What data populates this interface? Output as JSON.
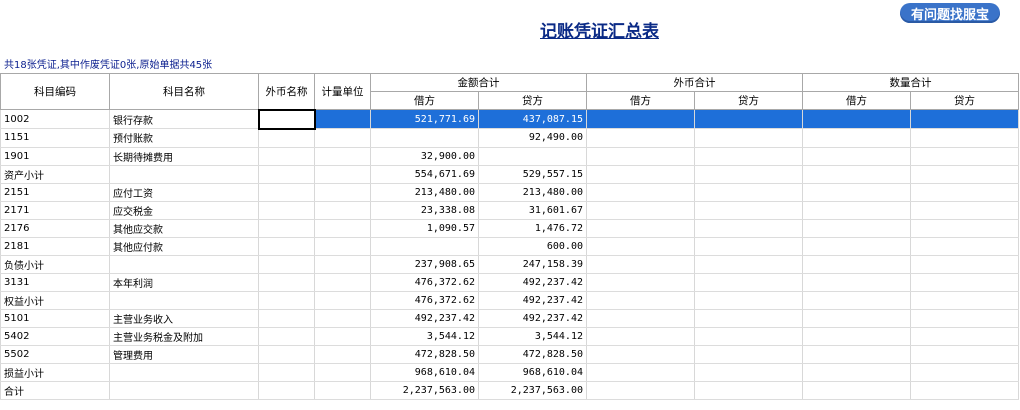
{
  "header": {
    "service_button": "有问题找服宝",
    "title": "记账凭证汇总表",
    "summary": "共18张凭证,其中作废凭证0张,原始单据共45张"
  },
  "columns": {
    "code": "科目编码",
    "name": "科目名称",
    "fc_name": "外币名称",
    "unit": "计量单位",
    "amount_total": "金额合计",
    "fc_total": "外币合计",
    "qty_total": "数量合计",
    "debit": "借方",
    "credit": "贷方"
  },
  "rows": [
    {
      "code": "1002",
      "name": "银行存款",
      "debit": "521,771.69",
      "credit": "437,087.15"
    },
    {
      "code": "1151",
      "name": "预付账款",
      "debit": "",
      "credit": "92,490.00"
    },
    {
      "code": "1901",
      "name": "长期待摊费用",
      "debit": "32,900.00",
      "credit": ""
    },
    {
      "code": "资产小计",
      "name": "",
      "debit": "554,671.69",
      "credit": "529,557.15"
    },
    {
      "code": "2151",
      "name": "应付工资",
      "debit": "213,480.00",
      "credit": "213,480.00"
    },
    {
      "code": "2171",
      "name": "应交税金",
      "debit": "23,338.08",
      "credit": "31,601.67"
    },
    {
      "code": "2176",
      "name": "其他应交款",
      "debit": "1,090.57",
      "credit": "1,476.72"
    },
    {
      "code": "2181",
      "name": "其他应付款",
      "debit": "",
      "credit": "600.00"
    },
    {
      "code": "负债小计",
      "name": "",
      "debit": "237,908.65",
      "credit": "247,158.39"
    },
    {
      "code": "3131",
      "name": "本年利润",
      "debit": "476,372.62",
      "credit": "492,237.42"
    },
    {
      "code": "权益小计",
      "name": "",
      "debit": "476,372.62",
      "credit": "492,237.42"
    },
    {
      "code": "5101",
      "name": "主营业务收入",
      "debit": "492,237.42",
      "credit": "492,237.42"
    },
    {
      "code": "5402",
      "name": "主营业务税金及附加",
      "debit": "3,544.12",
      "credit": "3,544.12"
    },
    {
      "code": "5502",
      "name": "管理费用",
      "debit": "472,828.50",
      "credit": "472,828.50"
    },
    {
      "code": "损益小计",
      "name": "",
      "debit": "968,610.04",
      "credit": "968,610.04"
    },
    {
      "code": "合计",
      "name": "",
      "debit": "2,237,563.00",
      "credit": "2,237,563.00"
    }
  ],
  "selected_row": 0,
  "colors": {
    "selection": "#1e6fd9",
    "title": "#0a2a86",
    "button": "#3a73c9"
  }
}
